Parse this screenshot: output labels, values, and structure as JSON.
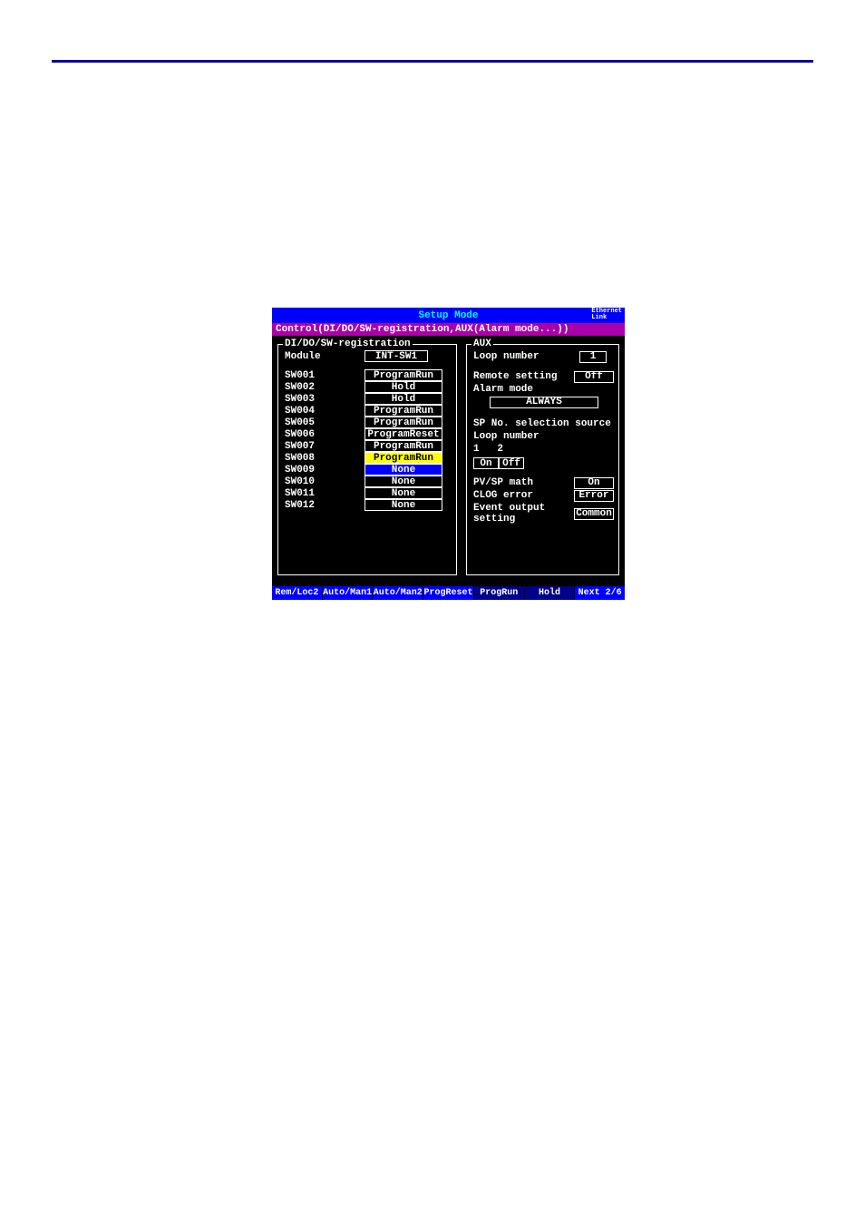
{
  "title": "Setup Mode",
  "ethernet": "Ethernet\nLink",
  "breadcrumb": "Control(DI/DO/SW-registration,AUX(Alarm mode...))",
  "left": {
    "title": "DI/DO/SW-registration",
    "module_label": "Module",
    "module_value": "INT-SW1",
    "rows": [
      {
        "label": "SW001",
        "value": "ProgramRun",
        "class": "normal"
      },
      {
        "label": "SW002",
        "value": "Hold",
        "class": "normal"
      },
      {
        "label": "SW003",
        "value": "Hold",
        "class": "normal"
      },
      {
        "label": "SW004",
        "value": "ProgramRun",
        "class": "normal"
      },
      {
        "label": "SW005",
        "value": "ProgramRun",
        "class": "normal"
      },
      {
        "label": "SW006",
        "value": "ProgramReset",
        "class": "normal"
      },
      {
        "label": "SW007",
        "value": "ProgramRun",
        "class": "normal"
      },
      {
        "label": "SW008",
        "value": "ProgramRun",
        "class": "yellow"
      },
      {
        "label": "SW009",
        "value": "None",
        "class": "blue"
      },
      {
        "label": "SW010",
        "value": "None",
        "class": "normal"
      },
      {
        "label": "SW011",
        "value": "None",
        "class": "normal"
      },
      {
        "label": "SW012",
        "value": "None",
        "class": "normal"
      }
    ]
  },
  "right": {
    "title": "AUX",
    "loop_number_label": "Loop number",
    "loop_number_value": "1",
    "remote_label": "Remote setting",
    "remote_value": "Off",
    "alarm_label": "Alarm mode",
    "alarm_value": "ALWAYS",
    "spsel_label": "SP No. selection source",
    "spsel_loop_label": "Loop number",
    "spsel_cols": "1   2",
    "spsel_on": "On",
    "spsel_off": "Off",
    "pvsp_label": "PV/SP math",
    "pvsp_value": "On",
    "clog_label": "CLOG error",
    "clog_value": "Error",
    "event_label": "Event output setting",
    "event_value": "Common"
  },
  "softkeys": [
    {
      "label": "Rem/Loc2",
      "class": ""
    },
    {
      "label": "Auto/Man1",
      "class": ""
    },
    {
      "label": "Auto/Man2",
      "class": ""
    },
    {
      "label": "ProgReset",
      "class": ""
    },
    {
      "label": "ProgRun",
      "class": "dark"
    },
    {
      "label": "Hold",
      "class": "dark"
    },
    {
      "label": "Next 2/6",
      "class": ""
    }
  ]
}
